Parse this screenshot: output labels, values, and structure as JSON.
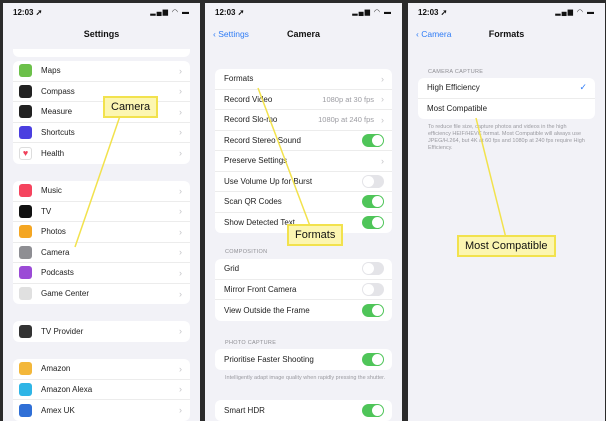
{
  "panels": {
    "settings": {
      "time": "12:03 ➚",
      "status_icons": "▂▄▆ ◠ ▬",
      "title": "Settings",
      "groups": [
        {
          "items": [
            {
              "label": "Maps",
              "color": "#6cc04a"
            },
            {
              "label": "Compass",
              "color": "#222222"
            },
            {
              "label": "Measure",
              "color": "#222222"
            },
            {
              "label": "Shortcuts",
              "color": "#4b3fe0"
            },
            {
              "label": "Health",
              "color": "#ffffff"
            }
          ]
        },
        {
          "items": [
            {
              "label": "Music",
              "color": "#f5445e"
            },
            {
              "label": "TV",
              "color": "#111111"
            },
            {
              "label": "Photos",
              "color": "#f4a623"
            },
            {
              "label": "Camera",
              "color": "#8e8e93"
            },
            {
              "label": "Podcasts",
              "color": "#9b4bd6"
            },
            {
              "label": "Game Center",
              "color": "#e0e0e0"
            }
          ]
        },
        {
          "items": [
            {
              "label": "TV Provider",
              "color": "#333333"
            }
          ]
        },
        {
          "items": [
            {
              "label": "Amazon",
              "color": "#f3b73a"
            },
            {
              "label": "Amazon Alexa",
              "color": "#2fb5e6"
            },
            {
              "label": "Amex UK",
              "color": "#2f6fd6"
            }
          ]
        }
      ]
    },
    "camera": {
      "time": "12:03 ➚",
      "status_icons": "▂▄▆ ◠ ▬",
      "back": "Settings",
      "title": "Camera",
      "group1": [
        {
          "label": "Formats",
          "type": "chevron"
        },
        {
          "label": "Record Video",
          "value": "1080p at 30 fps",
          "type": "chevron"
        },
        {
          "label": "Record Slo-mo",
          "value": "1080p at 240 fps",
          "type": "chevron"
        },
        {
          "label": "Record Stereo Sound",
          "type": "toggle",
          "on": true
        },
        {
          "label": "Preserve Settings",
          "type": "chevron"
        },
        {
          "label": "Use Volume Up for Burst",
          "type": "toggle",
          "on": false
        },
        {
          "label": "Scan QR Codes",
          "type": "toggle",
          "on": true
        },
        {
          "label": "Show Detected Text",
          "type": "toggle",
          "on": true
        }
      ],
      "composition_header": "Composition",
      "group2": [
        {
          "label": "Grid",
          "type": "toggle",
          "on": false
        },
        {
          "label": "Mirror Front Camera",
          "type": "toggle",
          "on": false
        },
        {
          "label": "View Outside the Frame",
          "type": "toggle",
          "on": true
        }
      ],
      "photo_capture_header": "Photo Capture",
      "group3": [
        {
          "label": "Prioritise Faster Shooting",
          "type": "toggle",
          "on": true
        }
      ],
      "photo_capture_note": "Intelligently adapt image quality when rapidly pressing the shutter.",
      "group4": [
        {
          "label": "Smart HDR",
          "type": "toggle",
          "on": true
        }
      ]
    },
    "formats": {
      "time": "12:03 ➚",
      "status_icons": "▂▄▆ ◠ ▬",
      "back": "Camera",
      "title": "Formats",
      "section_header": "Camera Capture",
      "options": [
        {
          "label": "High Efficiency",
          "selected": true
        },
        {
          "label": "Most Compatible",
          "selected": false
        }
      ],
      "note": "To reduce file size, capture photos and videos in the high efficiency HEIF/HEVC format. Most Compatible will always use JPEG/H.264, but 4K at 60 fps and 1080p at 240 fps require High Efficiency."
    }
  },
  "callouts": {
    "camera": "Camera",
    "formats": "Formats",
    "most_compatible": "Most Compatible"
  },
  "colors": {
    "accent": "#2f7cf6",
    "toggle_on": "#4fc559",
    "callout_bg": "#fcf6b1",
    "callout_border": "#f2e24d"
  }
}
